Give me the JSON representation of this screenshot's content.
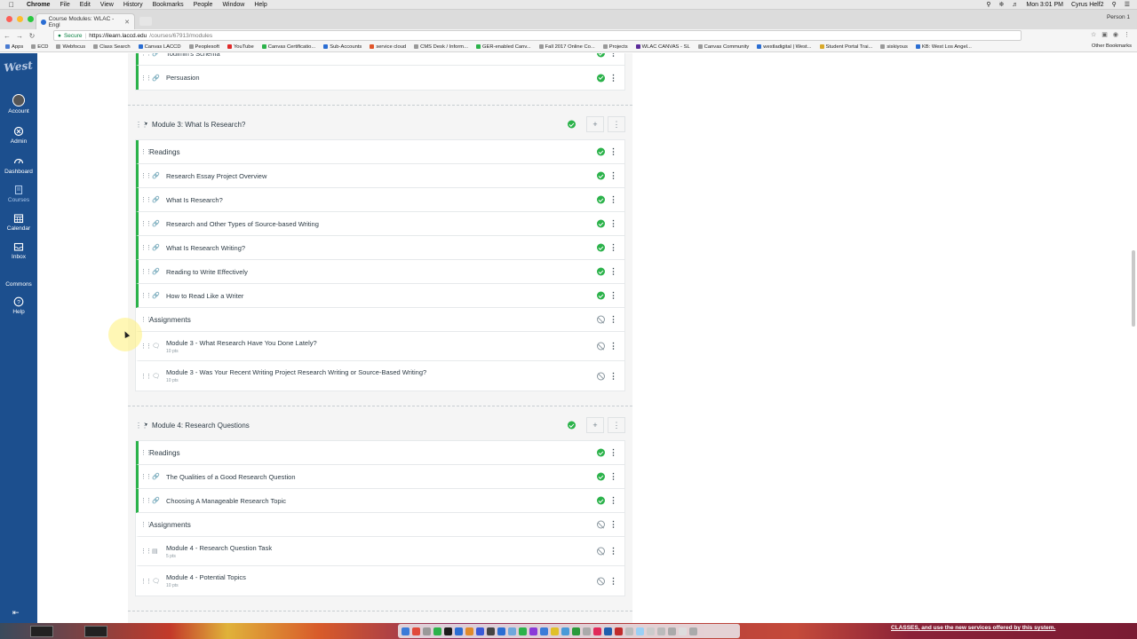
{
  "menubar": {
    "app": "Chrome",
    "items": [
      "File",
      "Edit",
      "View",
      "History",
      "Bookmarks",
      "People",
      "Window",
      "Help"
    ],
    "clock": "Mon 3:01 PM",
    "user": "Cyrus Helf2"
  },
  "browser": {
    "tab_title": "Course Modules: WLAC - Engl",
    "profile": "Person 1",
    "secure_label": "Secure",
    "url_host": "https://ilearn.laccd.edu",
    "url_path": "/courses/67913/modules"
  },
  "bookmarks": [
    {
      "label": "Apps",
      "color": "#4a7bd1"
    },
    {
      "label": "ECD",
      "color": "#999"
    },
    {
      "label": "Webfocus",
      "color": "#999"
    },
    {
      "label": "Class Search",
      "color": "#999"
    },
    {
      "label": "Canvas LACCD",
      "color": "#2a6dd3"
    },
    {
      "label": "Peoplesoft",
      "color": "#999"
    },
    {
      "label": "YouTube",
      "color": "#e02a2a"
    },
    {
      "label": "Canvas Certificatio...",
      "color": "#2bb24a"
    },
    {
      "label": "Sub-Accounts",
      "color": "#2a6dd3"
    },
    {
      "label": "service cloud",
      "color": "#e0552a"
    },
    {
      "label": "CMS Desk / Inform...",
      "color": "#999"
    },
    {
      "label": "GER-enabled Canv...",
      "color": "#2bb24a"
    },
    {
      "label": "Fall 2017 Online Co...",
      "color": "#999"
    },
    {
      "label": "Projects",
      "color": "#999"
    },
    {
      "label": "WLAC CANVAS - SL",
      "color": "#5a2a9a"
    },
    {
      "label": "Canvas Community",
      "color": "#999"
    },
    {
      "label": "westladigital | West...",
      "color": "#2a6dd3"
    },
    {
      "label": "Student Portal Trai...",
      "color": "#d9a92a"
    },
    {
      "label": "siskiyous",
      "color": "#999"
    },
    {
      "label": "KB: West Los Angel...",
      "color": "#2a6dd3"
    }
  ],
  "other_bookmarks": "Other Bookmarks",
  "globalnav": {
    "logo": "West",
    "items": [
      {
        "label": "Account"
      },
      {
        "label": "Admin"
      },
      {
        "label": "Dashboard"
      },
      {
        "label": "Courses"
      },
      {
        "label": "Calendar"
      },
      {
        "label": "Inbox"
      },
      {
        "label": "Commons"
      },
      {
        "label": "Help"
      }
    ]
  },
  "modules": [
    {
      "title": "",
      "partial": true,
      "items": [
        {
          "kind": "link",
          "title": "Toulmin's Schema",
          "status": "published"
        },
        {
          "kind": "link",
          "title": "Persuasion",
          "status": "published"
        }
      ]
    },
    {
      "title": "Module 3: What Is Research?",
      "items": [
        {
          "kind": "header",
          "title": "Readings",
          "status": "published"
        },
        {
          "kind": "link",
          "title": "Research Essay Project Overview",
          "status": "published"
        },
        {
          "kind": "link",
          "title": "What Is Research?",
          "status": "published"
        },
        {
          "kind": "link",
          "title": "Research and Other Types of Source-based Writing",
          "status": "published"
        },
        {
          "kind": "link",
          "title": "What Is Research Writing?",
          "status": "published"
        },
        {
          "kind": "link",
          "title": "Reading to Write Effectively",
          "status": "published"
        },
        {
          "kind": "link",
          "title": "How to Read Like a Writer",
          "status": "published"
        },
        {
          "kind": "header",
          "title": "Assignments",
          "status": "unpublished"
        },
        {
          "kind": "discussion",
          "title": "Module 3 - What Research Have You Done Lately?",
          "points": "10 pts",
          "status": "unpublished"
        },
        {
          "kind": "discussion",
          "title": "Module 3 - Was Your Recent Writing Project Research Writing or Source-Based Writing?",
          "points": "10 pts",
          "status": "unpublished"
        }
      ]
    },
    {
      "title": "Module 4: Research Questions",
      "items": [
        {
          "kind": "header",
          "title": "Readings",
          "status": "published"
        },
        {
          "kind": "link",
          "title": "The Qualities of a Good Research Question",
          "status": "published"
        },
        {
          "kind": "link",
          "title": "Choosing A Manageable Research Topic",
          "status": "published"
        },
        {
          "kind": "header",
          "title": "Assignments",
          "status": "unpublished"
        },
        {
          "kind": "assignment",
          "title": "Module 4 - Research Question Task",
          "points": "5 pts",
          "status": "unpublished"
        },
        {
          "kind": "discussion",
          "title": "Module 4 - Potential Topics",
          "points": "10 pts",
          "status": "unpublished"
        }
      ]
    }
  ],
  "dock": {
    "banner": "CLASSES, and use the new services offered by this system."
  },
  "colors": {
    "nav_bg": "#1c4f8e",
    "published_green": "#2bb24a",
    "module_bg": "#f5f5f5"
  }
}
